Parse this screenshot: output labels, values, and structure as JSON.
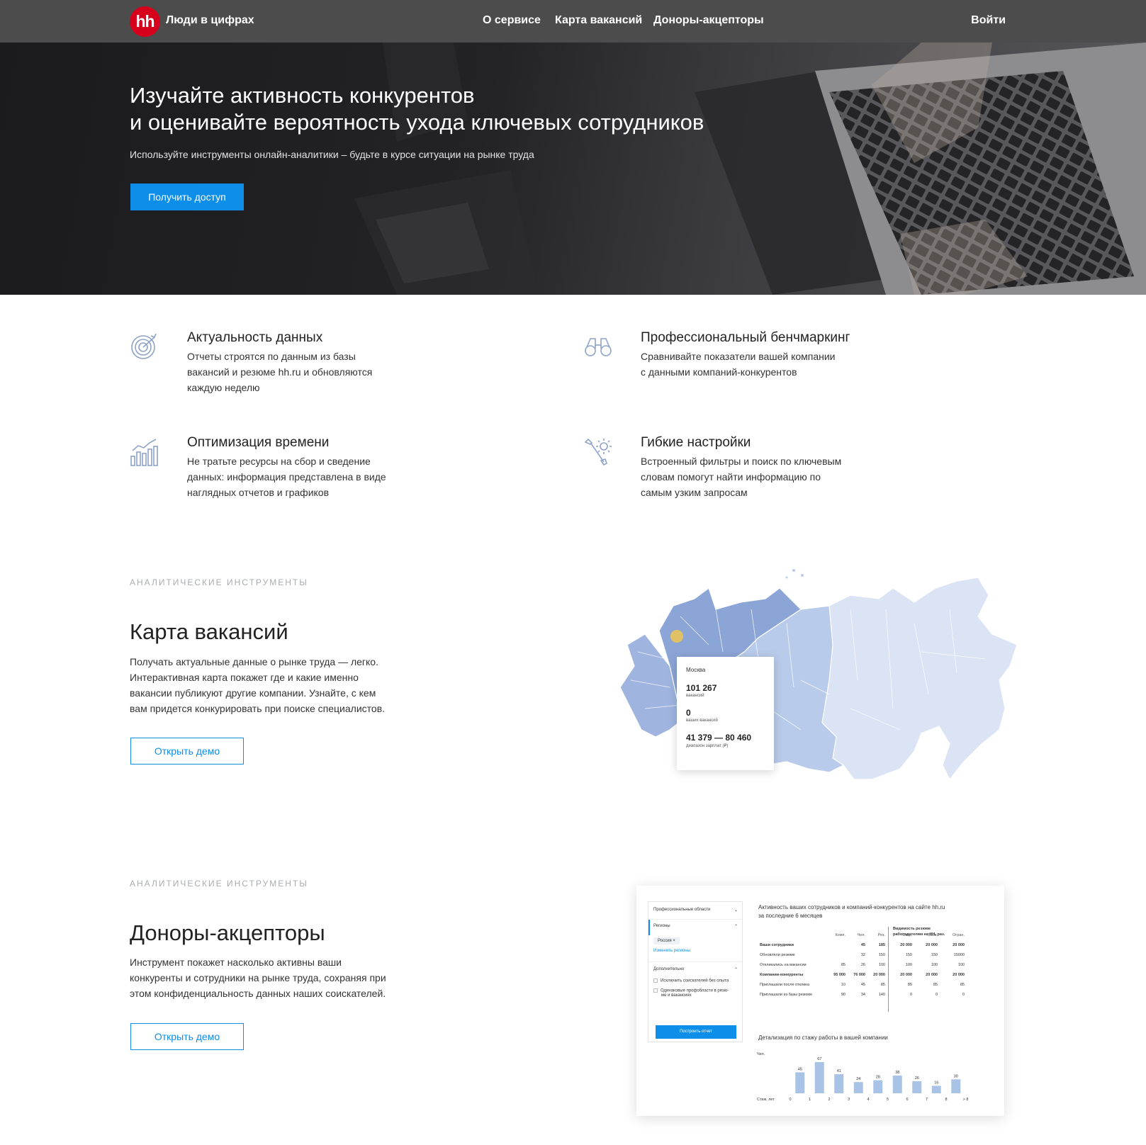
{
  "header": {
    "logo": "hh",
    "site_name": "Люди в цифрах",
    "nav": [
      "О сервисе",
      "Карта вакансий",
      "Доноры-акцепторы"
    ],
    "login": "Войти"
  },
  "hero": {
    "title_line1": "Изучайте активность конкурентов",
    "title_line2": "и оценивайте вероятность ухода ключевых сотрудников",
    "subtitle": "Используйте инструменты онлайн-аналитики – будьте в курсе ситуации на рынке труда",
    "cta": "Получить доступ"
  },
  "features": [
    {
      "icon": "target-icon",
      "title": "Актуальность данных",
      "lines": [
        "Отчеты строятся по данным из базы",
        "вакансий и резюме hh.ru и обновляются",
        "каждую неделю"
      ]
    },
    {
      "icon": "binoculars-icon",
      "title": "Профессиональный бенчмаркинг",
      "lines": [
        "Сравнивайте показатели вашей компании",
        "с данными компаний-конкурентов"
      ]
    },
    {
      "icon": "bar-chart-icon",
      "title": "Оптимизация времени",
      "lines": [
        "Не тратьте ресурсы на сбор и сведение",
        "данных: информация представлена в виде",
        "наглядных отчетов и графиков"
      ]
    },
    {
      "icon": "settings-tools-icon",
      "title": "Гибкие настройки",
      "lines": [
        "Встроенный фильтры и поиск по ключевым",
        "словам помогут найти информацию по",
        "самым узким запросам"
      ]
    }
  ],
  "map_section": {
    "eyebrow": "АНАЛИТИЧЕСКИЕ ИНСТРУМЕНТЫ",
    "title": "Карта вакансий",
    "lines": [
      "Получать актуальные данные о рынке труда — легко.",
      "Интерактивная карта покажет где и какие именно",
      "вакансии публикуют другие компании. Узнайте, с кем",
      "вам придется конкурировать при поиске специалистов."
    ],
    "button": "Открыть демо",
    "tooltip": {
      "city": "Москва",
      "vacancies": "101 267",
      "vacancies_label": "вакансий",
      "yours": "0",
      "yours_label": "ваших вакансий",
      "salary": "41 379 — 80 460",
      "salary_label": "диапазон зарплат (₽)"
    }
  },
  "donors_section": {
    "eyebrow": "АНАЛИТИЧЕСКИЕ ИНСТРУМЕНТЫ",
    "title": "Доноры-акцепторы",
    "lines": [
      "Инструмент покажет насколько активны ваши",
      "конкуренты и сотрудники на рынке труда, сохраняя при",
      "этом конфиденциальность данных наших соискателей."
    ],
    "button": "Открыть демо"
  },
  "report": {
    "filter_prof": "Профессиональные области",
    "filter_regions": "Регионы",
    "region_tag": "Россия",
    "change_regions": "Изменить регионы",
    "extra": "Дополнительно",
    "opt1": "Исключить соискателей без опыта",
    "opt2_line1": "Одинаковые профобласти в резю-",
    "opt2_line2": "ме и вакансиях",
    "build": "Построить отчет",
    "title_line1": "Активность ваших сотрудников и компаний-конкурентов на сайте hh.ru",
    "title_line2": "за последние 6 месяцев",
    "visibility_line1": "Видимость резюме",
    "visibility_line2": "работодателям на HH, раз.",
    "columns": [
      "Комп.",
      "Чел.",
      "Рез.",
      "Откр.",
      "Засл.",
      "Огран."
    ],
    "rows": [
      {
        "label": "Ваши сотрудники",
        "bold": true,
        "cells": [
          "",
          "45",
          "185",
          "20 000",
          "20 000",
          "20 000"
        ]
      },
      {
        "label": "Обновляли резюме",
        "bold": false,
        "cells": [
          "",
          "32",
          "150",
          "150",
          "150",
          "15000"
        ]
      },
      {
        "label": "Откликались на вакансии",
        "bold": false,
        "cells": [
          "85",
          "26",
          "100",
          "100",
          "100",
          "100"
        ]
      },
      {
        "label": "Компании-конкуренты",
        "bold": true,
        "cells": [
          "95 000",
          "76 000",
          "20 000",
          "20 000",
          "20 000",
          "20 000"
        ]
      },
      {
        "label": "Приглашали после отклика",
        "bold": false,
        "cells": [
          "10",
          "45",
          "85",
          "85",
          "85",
          "85"
        ]
      },
      {
        "label": "Приглашали из базы резюме",
        "bold": false,
        "cells": [
          "90",
          "34",
          "140",
          "0",
          "0",
          "0"
        ]
      }
    ],
    "chart_title": "Детализация по стажу работы в вашей компании",
    "y_label": "Чел.",
    "x_label": "Стаж, лет"
  },
  "chart_data": {
    "type": "bar",
    "title": "Детализация по стажу работы в вашей компании",
    "ylabel": "Чел.",
    "xlabel": "Стаж, лет",
    "categories": [
      "0",
      "1",
      "2",
      "3",
      "4",
      "5",
      "6",
      "7",
      "8"
    ],
    "tick_end": "> 8",
    "values": [
      45,
      67,
      41,
      24,
      28,
      38,
      26,
      16,
      30
    ],
    "ylim": [
      0,
      70
    ]
  },
  "colors": {
    "brand_red": "#d6001c",
    "accent_blue": "#0d8ee9",
    "map_dark": "#8ba5d6",
    "map_light": "#dae4f4",
    "bar": "#a9c3e6"
  }
}
